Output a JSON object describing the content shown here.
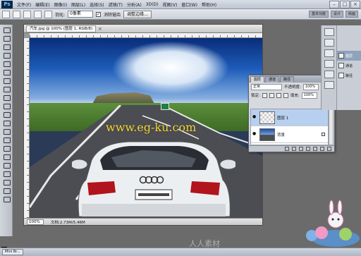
{
  "app": {
    "logo": "Ps"
  },
  "menu": [
    "文件(F)",
    "编辑(E)",
    "图像(I)",
    "图层(L)",
    "选择(S)",
    "滤镜(T)",
    "分析(A)",
    "3D(D)",
    "视图(V)",
    "窗口(W)",
    "帮助(H)"
  ],
  "options": {
    "feather_label": "羽化:",
    "feather_value": "0像素",
    "antialias_checked": "✓",
    "antialias_label": "消除锯齿",
    "refine_edge": "调整边缘..."
  },
  "workspace": [
    "基本功能",
    "设计",
    "绘画"
  ],
  "document": {
    "tab_label": "汽车.jpg @ 100% (图层 1, RGB/8)",
    "close": "×",
    "watermark": "www.eg-ku.com",
    "zoom": "100%",
    "doc_size": "文档:2.73M/5.46M"
  },
  "layers_panel": {
    "tabs": [
      "图层",
      "通道",
      "路径"
    ],
    "blend_mode": "正常",
    "opacity_label": "不透明度:",
    "opacity_value": "100%",
    "lock_label": "锁定:",
    "fill_label": "填充:",
    "fill_value": "100%",
    "layers": [
      {
        "name": "图层 1",
        "eye": "●",
        "selected": true
      },
      {
        "name": "背景",
        "eye": "●",
        "selected": false
      }
    ]
  },
  "dock": [
    {
      "label": "图层",
      "active": true
    },
    {
      "label": "通道",
      "active": false
    },
    {
      "label": "路径",
      "active": false
    }
  ],
  "taskbar": {
    "mini_bridge": "Mini Br..."
  },
  "site_watermark": "人人素材"
}
